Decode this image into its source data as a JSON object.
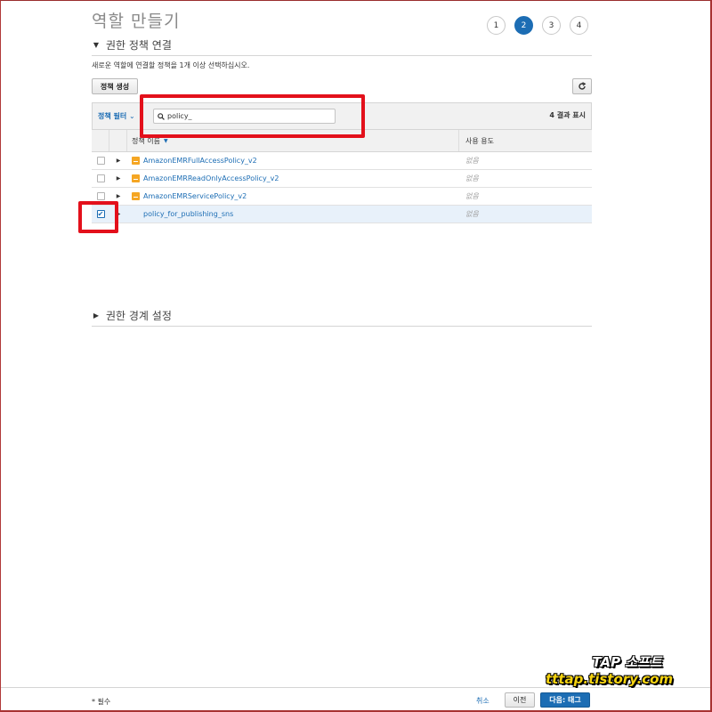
{
  "page": {
    "title": "역할 만들기",
    "steps": [
      "1",
      "2",
      "3",
      "4"
    ],
    "active_step": "2"
  },
  "attach_section": {
    "title": "권한 정책 연결",
    "description": "새로운 역할에 연결할 정책을 1개 이상 선택하십시오.",
    "create_policy_label": "정책 생성",
    "refresh_icon": "refresh-icon"
  },
  "filter": {
    "label": "정책 필터",
    "search_value": "policy_",
    "result_count": "4 결과 표시"
  },
  "table": {
    "columns": {
      "name": "정책 이름",
      "usage": "사용 용도"
    },
    "rows": [
      {
        "name": "AmazonEMRFullAccessPolicy_v2",
        "usage": "없음",
        "aws_managed": true,
        "checked": false
      },
      {
        "name": "AmazonEMRReadOnlyAccessPolicy_v2",
        "usage": "없음",
        "aws_managed": true,
        "checked": false
      },
      {
        "name": "AmazonEMRServicePolicy_v2",
        "usage": "없음",
        "aws_managed": true,
        "checked": false
      },
      {
        "name": "policy_for_publishing_sns",
        "usage": "없음",
        "aws_managed": false,
        "checked": true
      }
    ]
  },
  "boundary_section": {
    "title": "권한 경계 설정"
  },
  "footer": {
    "required_note": "* 필수",
    "cancel_label": "취소",
    "prev_label": "이전",
    "next_label": "다음: 태그"
  },
  "watermark": {
    "line1": "TAP 소프트",
    "line2": "tttap.tistory.com"
  },
  "colors": {
    "accent": "#1c6db4",
    "highlight": "#e3101b",
    "aws_orange": "#f5a623"
  }
}
